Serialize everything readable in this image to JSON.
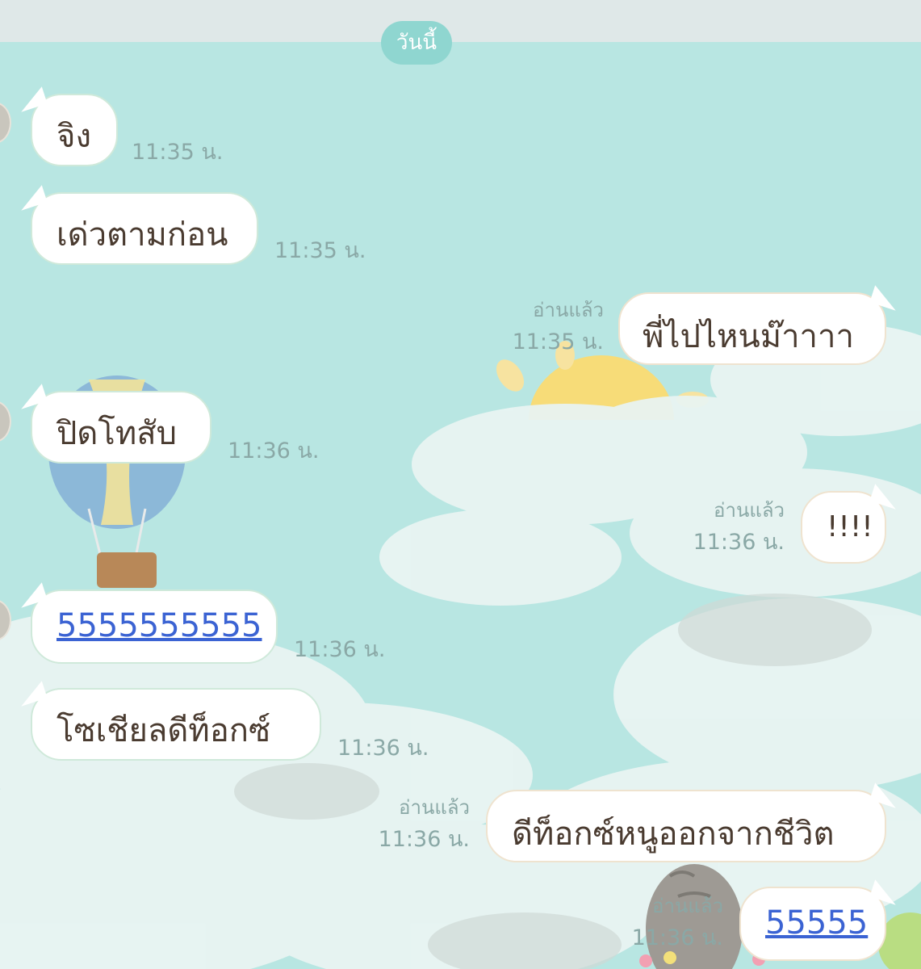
{
  "header": {
    "date_label": "วันนี้"
  },
  "read_label": "อ่านแล้ว",
  "messages": [
    {
      "side": "in",
      "text": "จิง",
      "time": "11:35 น."
    },
    {
      "side": "in",
      "text": "เด่วตามก่อน",
      "time": "11:35 น."
    },
    {
      "side": "out",
      "text": "พี่ไปไหนม๊าาาา",
      "time": "11:35 น.",
      "read": "อ่านแล้ว"
    },
    {
      "side": "in",
      "text": "ปิดโทสับ",
      "time": "11:36 น."
    },
    {
      "side": "out",
      "text": "!!!!",
      "time": "11:36 น.",
      "read": "อ่านแล้ว"
    },
    {
      "side": "in",
      "text": "5555555555",
      "time": "11:36 น.",
      "link": true
    },
    {
      "side": "in",
      "text": "โซเชียลดีท็อกซ์",
      "time": "11:36 น."
    },
    {
      "side": "out",
      "text": "ดีท็อกซ์หนูออกจากชีวิต",
      "time": "11:36 น.",
      "read": "อ่านแล้ว"
    },
    {
      "side": "out",
      "text": "55555",
      "time": "11:36 น.",
      "read": "อ่านแล้ว",
      "link": true
    }
  ],
  "colors": {
    "sky": "#b8e6e2",
    "bubble": "#ffffff",
    "text": "#4a3b30",
    "timestamp": "#8aa8a6",
    "link": "#3b63d3",
    "date_pill": "#8fd6d0"
  }
}
